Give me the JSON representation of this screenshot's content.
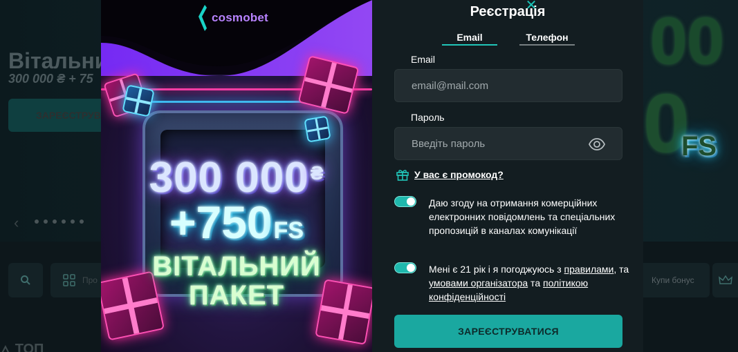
{
  "background": {
    "hero_title": "Вітальни",
    "hero_subtitle": "300 000 ₴ + 75",
    "hero_button": "ЗАРЕЄСТРУВА",
    "right_art_top": "00",
    "right_art_mid": "0",
    "right_art_fs": "FS",
    "category_label": "Про",
    "bonus_buy_label": "Купи бонус",
    "top_section": "ТОП"
  },
  "promo": {
    "logo": "cosmobet",
    "amount": "300 000",
    "currency": "₴",
    "free_spins": "+750",
    "free_spins_unit": "FS",
    "welcome": "ВІТАЛЬНИЙ",
    "package": "ПАКЕТ"
  },
  "form": {
    "title": "Реєстрація",
    "tabs": {
      "email": "Email",
      "phone": "Телефон"
    },
    "email": {
      "label": "Email",
      "placeholder": "email@mail.com"
    },
    "password": {
      "label": "Пароль",
      "placeholder": "Введіть пароль"
    },
    "promo_code_link": "У вас є промокод?",
    "consent_marketing": "Даю згоду на отримання комерційних електронних повідомлень та спеціальних пропозицій в каналах комунікації",
    "consent_age": {
      "text_1": "Мені є 21 рік і я погоджуюсь з ",
      "rules_link": "правилами",
      "text_2": ", та ",
      "terms_link": "умовами організатора",
      "text_3": " та ",
      "privacy_link": "політикою конфіденційності"
    },
    "submit": "ЗАРЕЄСТРУВАТИСЯ",
    "close": "✕"
  },
  "colors": {
    "accent": "#1aa8a0",
    "brand_purple": "#8a3cff",
    "form_bg": "#131d21"
  }
}
